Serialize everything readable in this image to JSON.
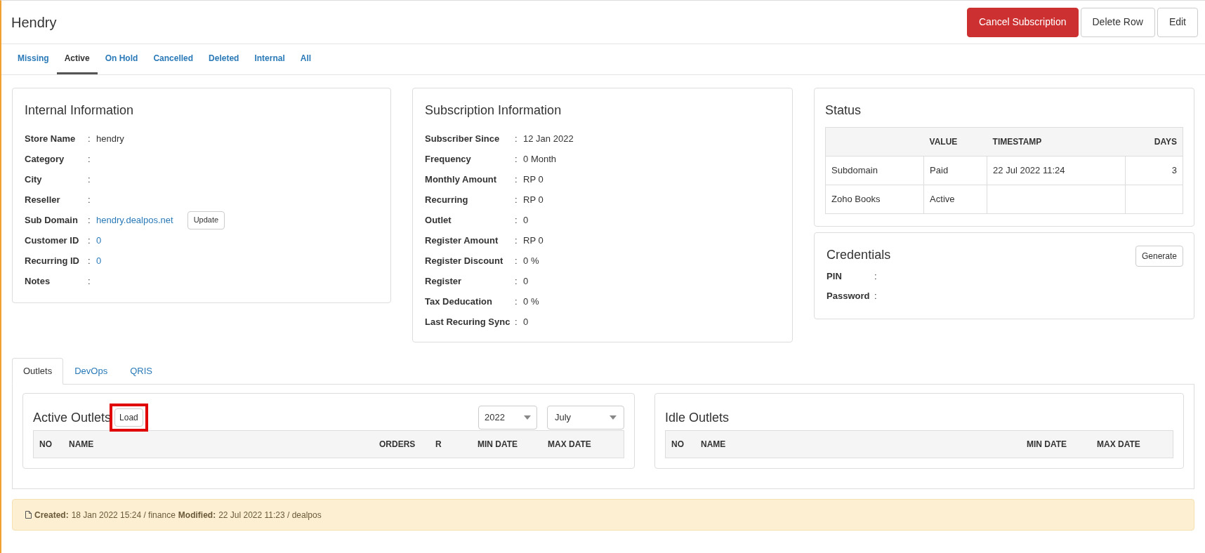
{
  "title": "Hendry",
  "actions": [
    {
      "label": "Cancel Subscription",
      "kind": "danger"
    },
    {
      "label": "Delete Row",
      "kind": "default"
    },
    {
      "label": "Edit",
      "kind": "default"
    }
  ],
  "status_tabs": [
    {
      "label": "Missing",
      "selected": false
    },
    {
      "label": "Active",
      "selected": true
    },
    {
      "label": "On Hold",
      "selected": false
    },
    {
      "label": "Cancelled",
      "selected": false
    },
    {
      "label": "Deleted",
      "selected": false
    },
    {
      "label": "Internal",
      "selected": false
    },
    {
      "label": "All",
      "selected": false
    }
  ],
  "internal": {
    "title": "Internal Information",
    "fields": [
      {
        "label": "Store Name",
        "colon": ":",
        "value": "hendry",
        "kind": "text"
      },
      {
        "label": "Category",
        "colon": ":"
      },
      {
        "label": "City",
        "colon": ":"
      },
      {
        "label": "Reseller",
        "colon": ":"
      },
      {
        "label": "Sub Domain",
        "colon": ":",
        "value": "hendry.dealpos.net",
        "kind": "link",
        "button": "Update"
      },
      {
        "label": "Customer ID",
        "colon": ":",
        "value": "0",
        "kind": "link"
      },
      {
        "label": "Recurring ID",
        "colon": ":",
        "value": "0",
        "kind": "link"
      },
      {
        "label": "Notes",
        "colon": ":"
      }
    ]
  },
  "subscription": {
    "title": "Subscription Information",
    "fields": [
      {
        "label": "Subscriber Since",
        "colon": ":",
        "value": "12 Jan 2022"
      },
      {
        "label": "Frequency",
        "colon": ":",
        "value": "0 Month"
      },
      {
        "label": "Monthly Amount",
        "colon": ":",
        "value": "RP 0"
      },
      {
        "label": "Recurring",
        "colon": ":",
        "value": "RP 0"
      },
      {
        "label": "Outlet",
        "colon": ":",
        "value": "0"
      },
      {
        "label": "Register Amount",
        "colon": ":",
        "value": "RP 0"
      },
      {
        "label": "Register Discount",
        "colon": ":",
        "value": "0 %"
      },
      {
        "label": "Register",
        "colon": ":",
        "value": "0"
      },
      {
        "label": "Tax Deducation",
        "colon": ":",
        "value": "0 %"
      },
      {
        "label": "Last Recuring Sync",
        "colon": ":",
        "value": "0"
      }
    ]
  },
  "status": {
    "title": "Status",
    "columns": [
      "VALUE",
      "TIMESTAMP",
      "DAYS"
    ],
    "rows": [
      {
        "name": "Subdomain",
        "value": "Paid",
        "timestamp": "22 Jul 2022 11:24",
        "days": "3"
      },
      {
        "name": "Zoho Books",
        "value": "Active"
      }
    ]
  },
  "credentials": {
    "title": "Credentials",
    "button": "Generate",
    "fields": [
      {
        "label": "PIN",
        "colon": ":"
      },
      {
        "label": "Password",
        "colon": ":"
      }
    ]
  },
  "outlet_tabs": [
    {
      "label": "Outlets",
      "selected": true
    },
    {
      "label": "DevOps",
      "selected": false
    },
    {
      "label": "QRIS",
      "selected": false
    }
  ],
  "active_outlets": {
    "title": "Active Outlets",
    "load_button": {
      "label": "Load",
      "highlighted": true
    },
    "year": "2022",
    "month": "July",
    "columns": [
      "NO",
      "NAME",
      "ORDERS",
      "R",
      "MIN DATE",
      "MAX DATE"
    ]
  },
  "idle_outlets": {
    "title": "Idle Outlets",
    "columns": [
      "NO",
      "NAME",
      "MIN DATE",
      "MAX DATE"
    ]
  },
  "footer": {
    "created_label": "Created:",
    "created": "18 Jan 2022 15:24 / finance",
    "modified_label": "Modified:",
    "modified": "22 Jul 2022 11:23 / dealpos"
  }
}
